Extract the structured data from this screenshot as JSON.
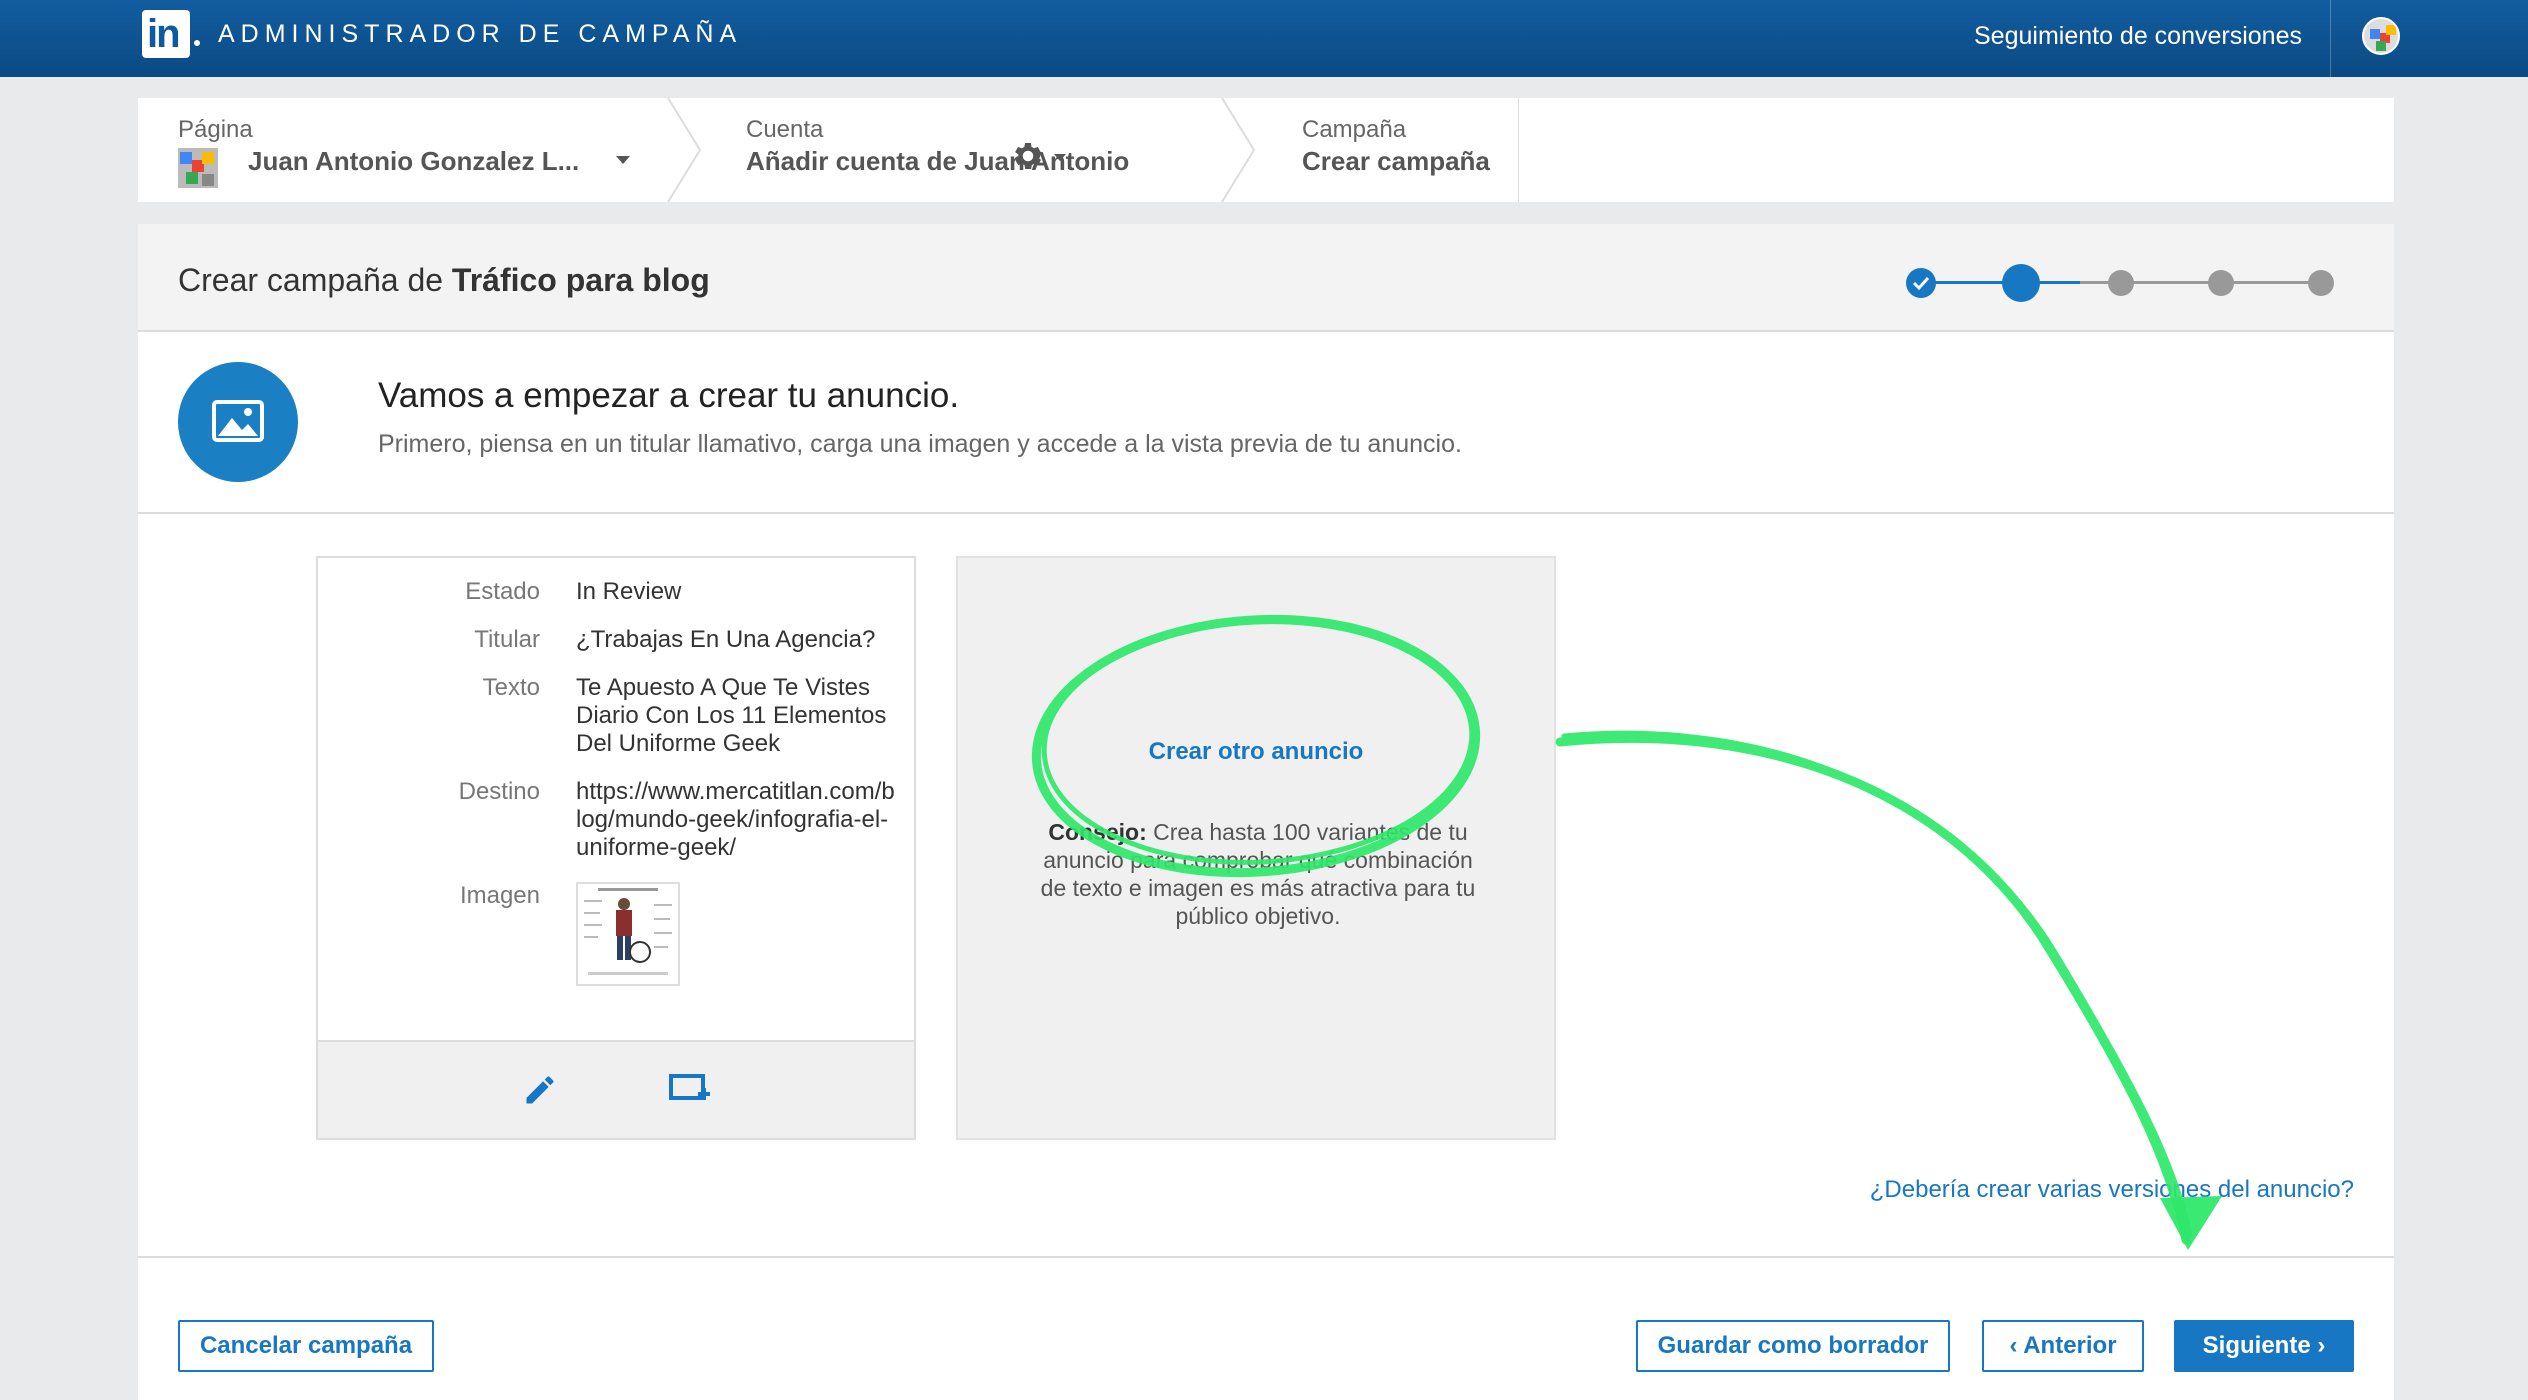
{
  "header": {
    "app_title": "ADMINISTRADOR DE CAMPAÑA",
    "conversions_link": "Seguimiento de conversiones",
    "logo_text": "in"
  },
  "breadcrumb": {
    "page": {
      "label": "Página",
      "value": "Juan Antonio Gonzalez L..."
    },
    "account": {
      "label": "Cuenta",
      "value": "Añadir cuenta de Juan Antonio"
    },
    "campaign": {
      "label": "Campaña",
      "value": "Crear campaña"
    }
  },
  "campaign": {
    "title_prefix": "Crear campaña de ",
    "title_name": "Tráfico para blog",
    "steps_total": 5,
    "current_step": 2,
    "completed_steps": 1
  },
  "intro": {
    "heading": "Vamos a empezar a crear tu anuncio.",
    "subtext": "Primero, piensa en un titular llamativo, carga una imagen y accede a la vista previa de tu anuncio."
  },
  "ad": {
    "status_label": "Estado",
    "status_value": "In Review",
    "headline_label": "Titular",
    "headline_value": "¿Trabajas En Una Agencia?",
    "text_label": "Texto",
    "text_value": "Te Apuesto A Que Te Vistes Diario Con Los 11 Elementos Del Uniforme Geek",
    "destination_label": "Destino",
    "destination_value": "https://www.mercatitlan.com/blog/mundo-geek/infografia-el-uniforme-geek/",
    "image_label": "Imagen"
  },
  "create_panel": {
    "link": "Crear otro anuncio",
    "tip_bold": "Consejo:",
    "tip_text": " Crea hasta 100 variantes de tu anuncio para comprobar qué combinación de texto e imagen es más atractiva para tu público objetivo."
  },
  "versions_link": "¿Debería crear varias versiones del anuncio?",
  "buttons": {
    "cancel": "Cancelar campaña",
    "save_draft": "Guardar como borrador",
    "previous": "‹ Anterior",
    "next": "Siguiente ›"
  },
  "colors": {
    "brand": "#0d5a9e",
    "accent": "#1877c2",
    "annotation": "#2ee86a"
  }
}
